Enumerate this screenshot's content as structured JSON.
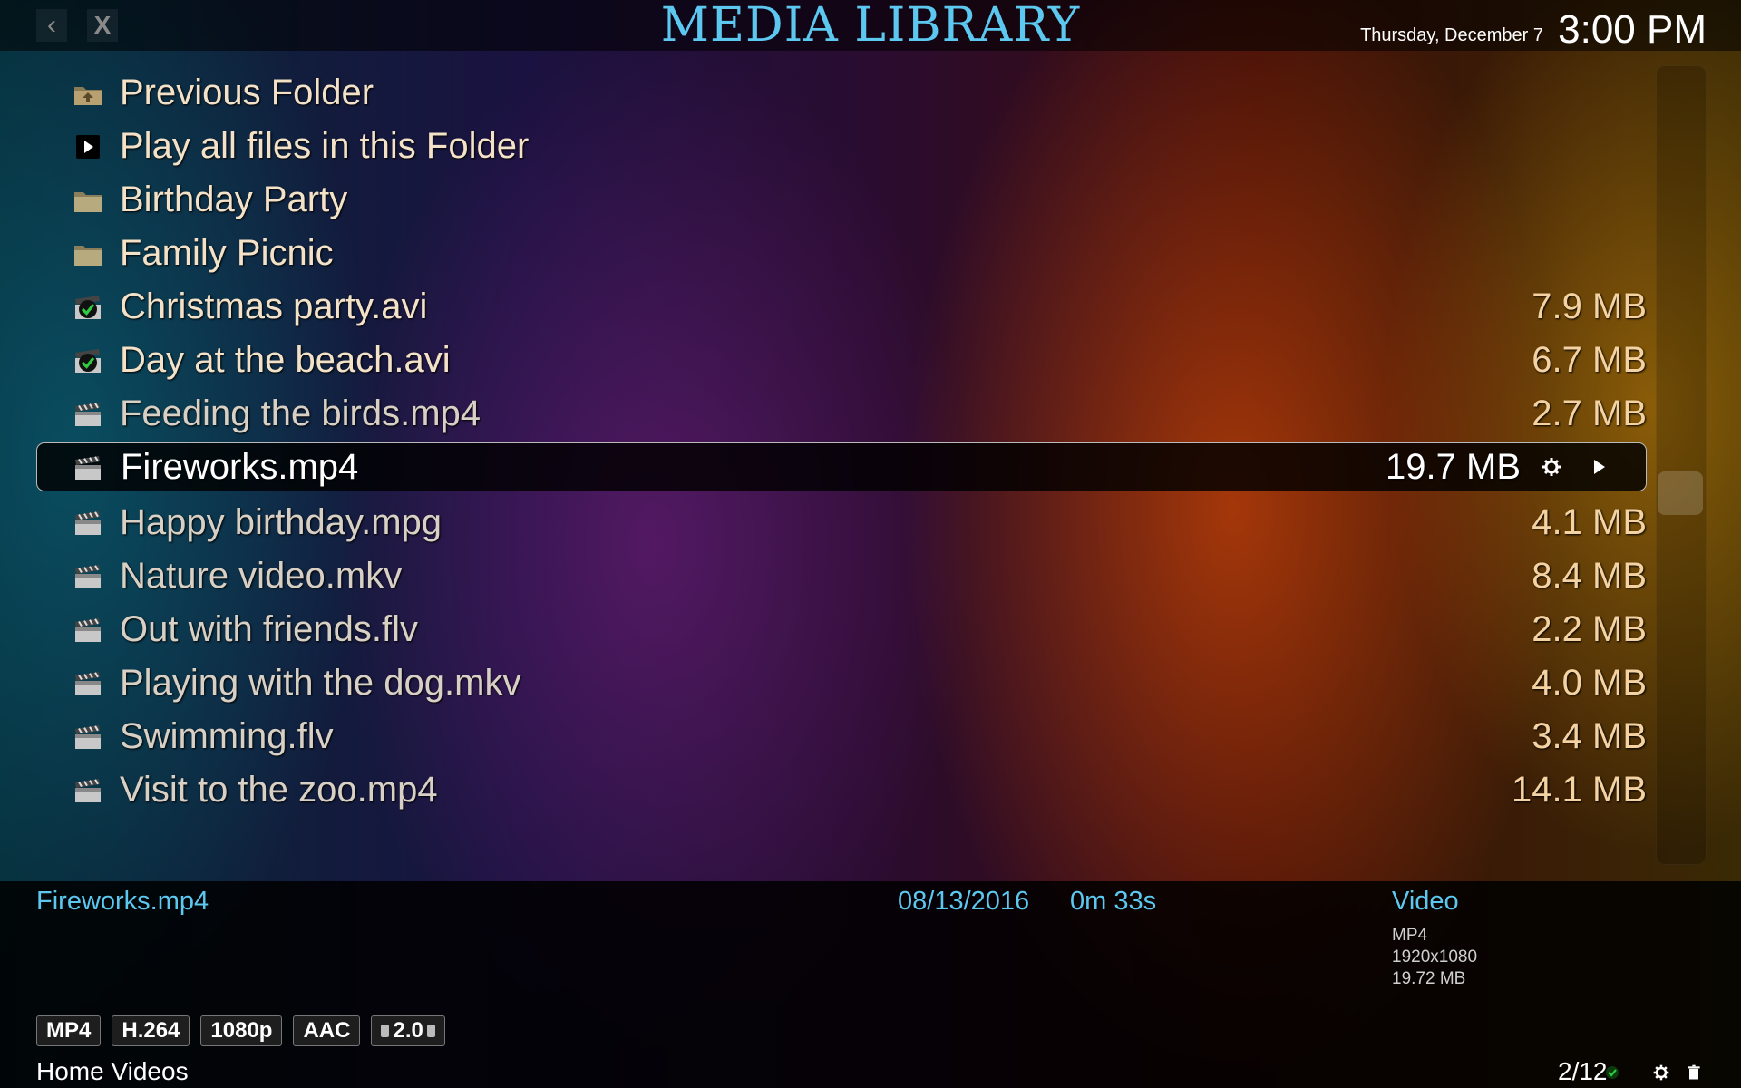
{
  "header": {
    "back_label": "‹",
    "close_label": "X",
    "title": "MEDIA LIBRARY",
    "date": "Thursday, December 7",
    "time": "3:00 PM"
  },
  "items": [
    {
      "name": "Previous Folder",
      "size": "",
      "icon": "folder-up-icon"
    },
    {
      "name": "Play all files in this Folder",
      "size": "",
      "icon": "play-icon"
    },
    {
      "name": "Birthday Party",
      "size": "",
      "icon": "folder-icon"
    },
    {
      "name": "Family Picnic",
      "size": "",
      "icon": "folder-icon"
    },
    {
      "name": "Christmas party.avi",
      "size": "7.9 MB",
      "icon": "watched-video-icon"
    },
    {
      "name": "Day at the beach.avi",
      "size": "6.7 MB",
      "icon": "watched-video-icon"
    },
    {
      "name": "Feeding the birds.mp4",
      "size": "2.7 MB",
      "icon": "clapperboard-icon"
    },
    {
      "name": "Fireworks.mp4",
      "size": "19.7 MB",
      "icon": "clapperboard-icon"
    },
    {
      "name": "Happy birthday.mpg",
      "size": "4.1 MB",
      "icon": "clapperboard-icon"
    },
    {
      "name": "Nature video.mkv",
      "size": "8.4 MB",
      "icon": "clapperboard-icon"
    },
    {
      "name": "Out with friends.flv",
      "size": "2.2 MB",
      "icon": "clapperboard-icon"
    },
    {
      "name": "Playing with the dog.mkv",
      "size": "4.0 MB",
      "icon": "clapperboard-icon"
    },
    {
      "name": "Swimming.flv",
      "size": "3.4 MB",
      "icon": "clapperboard-icon"
    },
    {
      "name": "Visit to the zoo.mp4",
      "size": "14.1 MB",
      "icon": "clapperboard-icon"
    }
  ],
  "selected_index": 7,
  "info": {
    "name": "Fireworks.mp4",
    "date": "08/13/2016",
    "duration": "0m 33s",
    "type": "Video",
    "container": "MP4",
    "resolution": "1920x1080",
    "filesize": "19.72 MB"
  },
  "flags": [
    "MP4",
    "H.264",
    "1080p",
    "AAC",
    "2.0"
  ],
  "footer": {
    "section": "Home Videos",
    "counter": "2/12"
  },
  "colors": {
    "accent": "#5cc8f0",
    "item_text": "#f3e2c8",
    "size_text": "#f4d2a2",
    "watched_check": "#2ecc40"
  }
}
